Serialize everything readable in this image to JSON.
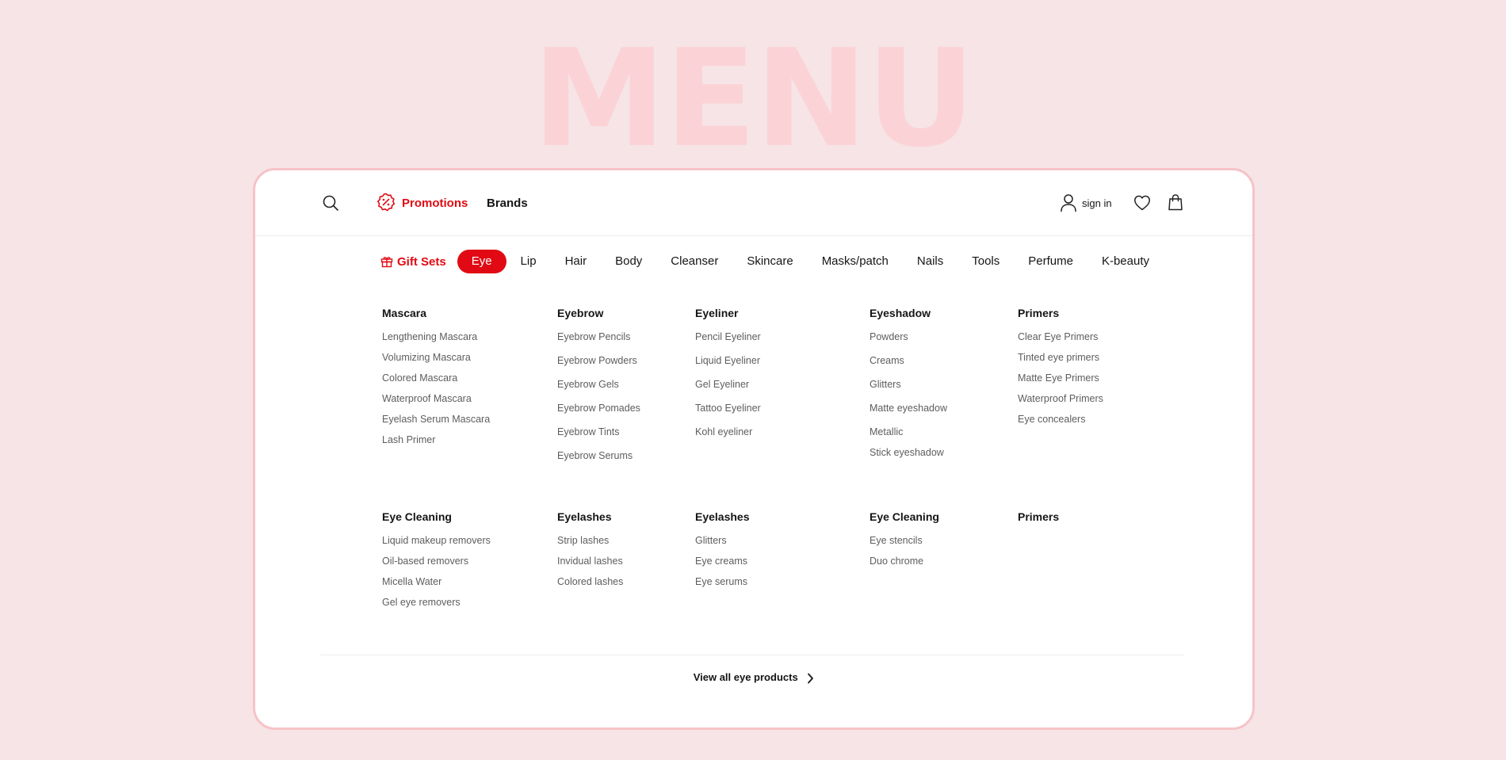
{
  "hero_title": "MENU",
  "brand_color": "#e10a14",
  "header": {
    "search_icon": "search-icon",
    "promotions_label": "Promotions",
    "promotions_icon": "discount-badge-icon",
    "brands_label": "Brands",
    "signin_label": "sign in",
    "user_icon": "user-icon",
    "wishlist_icon": "heart-icon",
    "cart_icon": "shopping-bag-icon"
  },
  "tabs": {
    "gift_sets": "Gift Sets",
    "gift_icon": "gift-icon",
    "items": [
      "Eye",
      "Lip",
      "Hair",
      "Body",
      "Cleanser",
      "Skincare",
      "Masks/patch",
      "Nails",
      "Tools",
      "Perfume",
      "K-beauty"
    ],
    "active": "Eye"
  },
  "menu": {
    "mascara": {
      "title": "Mascara",
      "items": [
        "Lengthening Mascara",
        "Volumizing Mascara",
        "Colored Mascara",
        "Waterproof Mascara",
        "Eyelash Serum Mascara",
        "Lash Primer"
      ]
    },
    "eyebrow": {
      "title": "Eyebrow",
      "items": [
        "Eyebrow Pencils",
        "Eyebrow Powders",
        "Eyebrow Gels",
        "Eyebrow Pomades",
        "Eyebrow Tints",
        "Eyebrow Serums"
      ]
    },
    "eyeliner": {
      "title": "Eyeliner",
      "items": [
        "Pencil Eyeliner",
        "Liquid Eyeliner",
        "Gel Eyeliner",
        "Tattoo Eyeliner",
        "Kohl eyeliner"
      ]
    },
    "eyeshadow": {
      "title": "Eyeshadow",
      "items": [
        "Powders",
        "Creams",
        "Glitters",
        "Matte eyeshadow",
        "Metallic",
        "Stick eyeshadow"
      ]
    },
    "primers": {
      "title": "Primers",
      "items": [
        "Clear Eye Primers",
        "Tinted eye primers",
        "Matte Eye Primers",
        "Waterproof Primers",
        "Eye concealers"
      ]
    },
    "eye_cleaning": {
      "title": "Eye Cleaning",
      "items": [
        "Liquid makeup removers",
        "Oil-based removers",
        "Micella Water",
        "Gel eye removers"
      ]
    },
    "eyelashes": {
      "title": "Eyelashes",
      "items": [
        "Strip lashes",
        "Invidual lashes",
        "Colored lashes"
      ]
    },
    "eyelashes_2": {
      "title": "Eyelashes",
      "items": [
        "Glitters",
        "Eye creams",
        "Eye serums"
      ]
    },
    "eye_cleaning_2": {
      "title": "Eye Cleaning",
      "items": [
        "Eye stencils",
        "Duo chrome"
      ]
    },
    "primers_2": {
      "title": "Primers",
      "items": []
    }
  },
  "footer": {
    "view_all_label": "View all eye products",
    "arrow_icon": "chevron-right-icon"
  }
}
